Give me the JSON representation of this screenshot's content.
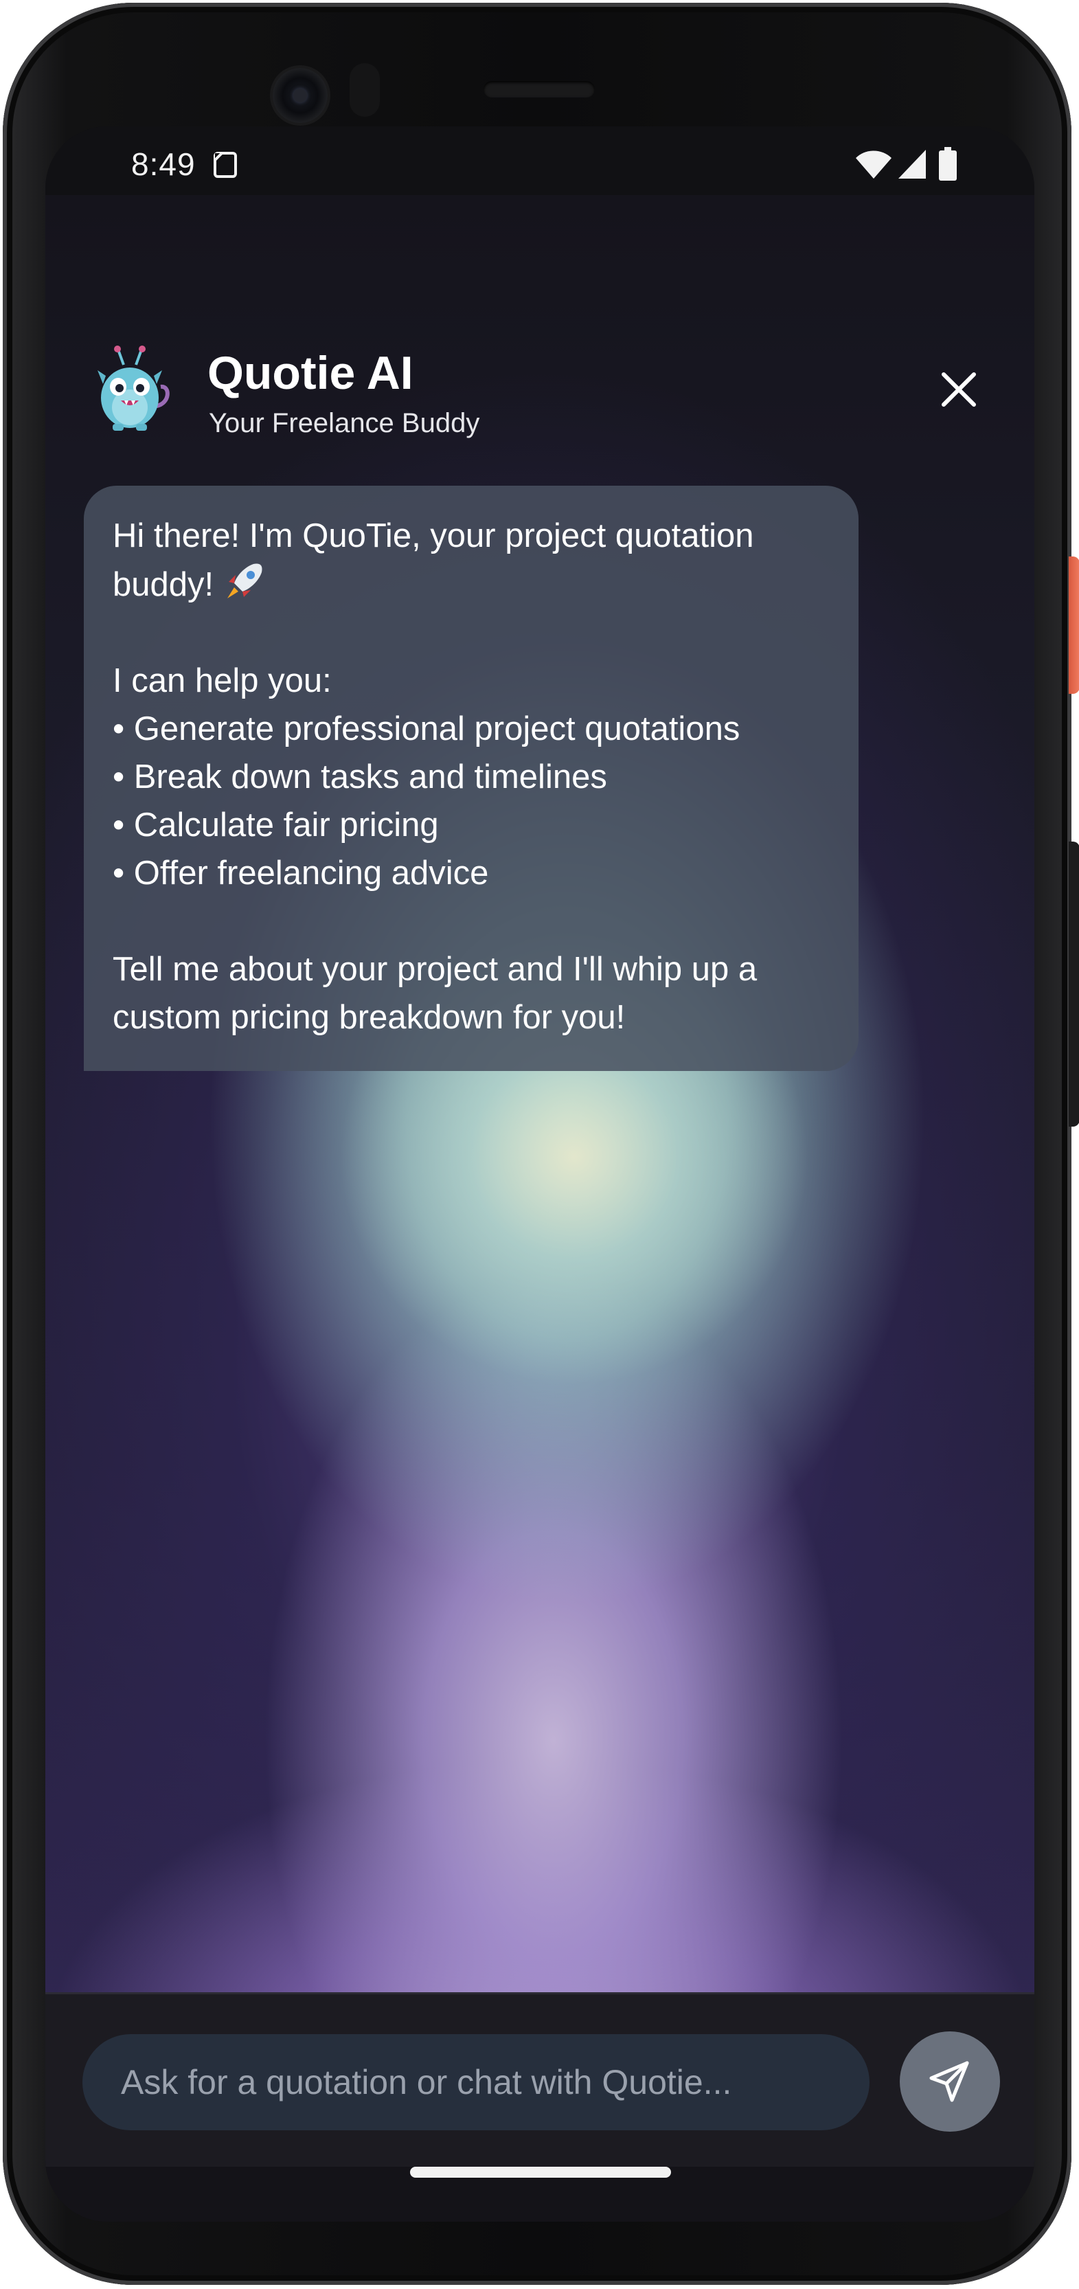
{
  "status_bar": {
    "time": "8:49",
    "icons": [
      "sim-card-icon",
      "wifi-icon",
      "cell-signal-icon",
      "battery-icon"
    ]
  },
  "header": {
    "title": "Quotie AI",
    "subtitle": "Your Freelance Buddy",
    "avatar_icon": "monster-mascot-icon",
    "close_icon": "close-icon"
  },
  "chat": {
    "messages": [
      {
        "sender": "assistant",
        "intro": "Hi there! I'm QuoTie, your project quotation buddy!",
        "intro_emoji": "rocket-icon",
        "help_heading": "I can help you:",
        "bullets": [
          "• Generate professional project quotations",
          "• Break down tasks and timelines",
          "• Calculate fair pricing",
          "• Offer freelancing advice"
        ],
        "closing": "Tell me about your project and I'll whip up a custom pricing breakdown for you!"
      }
    ]
  },
  "composer": {
    "placeholder": "Ask for a quotation or chat with Quotie...",
    "value": "",
    "send_icon": "send-icon"
  },
  "colors": {
    "bubble": "#485060",
    "input_field": "#262f3d",
    "send_button": "#6a717d",
    "phone_power_button": "#f07b5e"
  }
}
